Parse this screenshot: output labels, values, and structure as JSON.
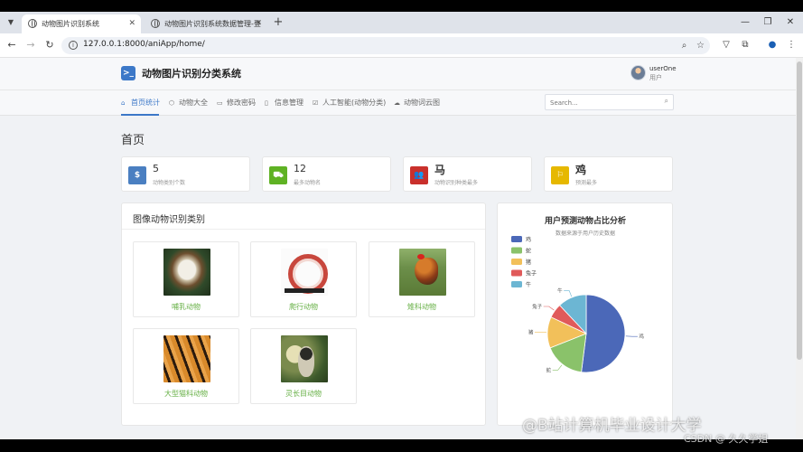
{
  "browser": {
    "tabs": [
      {
        "label": "动物图片识别系统",
        "active": true
      },
      {
        "label": "动物图片识别系统数据管理-登",
        "active": false
      }
    ],
    "url": "127.0.0.1:8000/aniApp/home/"
  },
  "header": {
    "app_title": "动物图片识别分类系统",
    "user_name": "userOne",
    "user_role": "用户"
  },
  "nav": {
    "items": [
      {
        "label": "首页统计",
        "icon": "home-icon",
        "active": true
      },
      {
        "label": "动物大全",
        "icon": "cube-icon",
        "active": false
      },
      {
        "label": "修改密码",
        "icon": "calendar-icon",
        "active": false
      },
      {
        "label": "信息管理",
        "icon": "file-icon",
        "active": false
      },
      {
        "label": "人工智能(动物分类)",
        "icon": "check-square-icon",
        "active": false
      },
      {
        "label": "动物词云图",
        "icon": "cloud-icon",
        "active": false
      }
    ],
    "search_placeholder": "Search..."
  },
  "page_title": "首页",
  "stats": [
    {
      "value": "5",
      "label": "动物类别个数",
      "icon": "dollar-icon",
      "color": "#4a7fc1"
    },
    {
      "value": "12",
      "label": "最多动物名",
      "icon": "cart-icon",
      "color": "#5fb224"
    },
    {
      "value": "马",
      "label": "动物识别种类最多",
      "icon": "users-icon",
      "color": "#c9302c"
    },
    {
      "value": "鸡",
      "label": "预测最多",
      "icon": "flag-icon",
      "color": "#e6b800"
    }
  ],
  "categories_panel": {
    "title": "图像动物识别类别",
    "items": [
      {
        "label": "哺乳动物",
        "image": "dog-image"
      },
      {
        "label": "爬行动物",
        "image": "snake-image"
      },
      {
        "label": "雉科动物",
        "image": "rooster-image"
      },
      {
        "label": "大型猫科动物",
        "image": "tiger-image"
      },
      {
        "label": "灵长目动物",
        "image": "monkey-image"
      }
    ]
  },
  "chart_data": {
    "type": "pie",
    "title": "用户预测动物占比分析",
    "subtitle": "数据来源于用户历史数据",
    "legend_position": "top-left",
    "slices": [
      {
        "name": "鸡",
        "value": 52,
        "color": "#4b68b8"
      },
      {
        "name": "蛇",
        "value": 17,
        "color": "#8ac26a"
      },
      {
        "name": "猪",
        "value": 13,
        "color": "#f2c05a"
      },
      {
        "name": "兔子",
        "value": 6,
        "color": "#e05a5a"
      },
      {
        "name": "牛",
        "value": 12,
        "color": "#6cb6d3"
      }
    ]
  },
  "watermark": {
    "main": "@B站计算机毕业设计大学",
    "sub": "CSDN @ 久久学姐"
  }
}
